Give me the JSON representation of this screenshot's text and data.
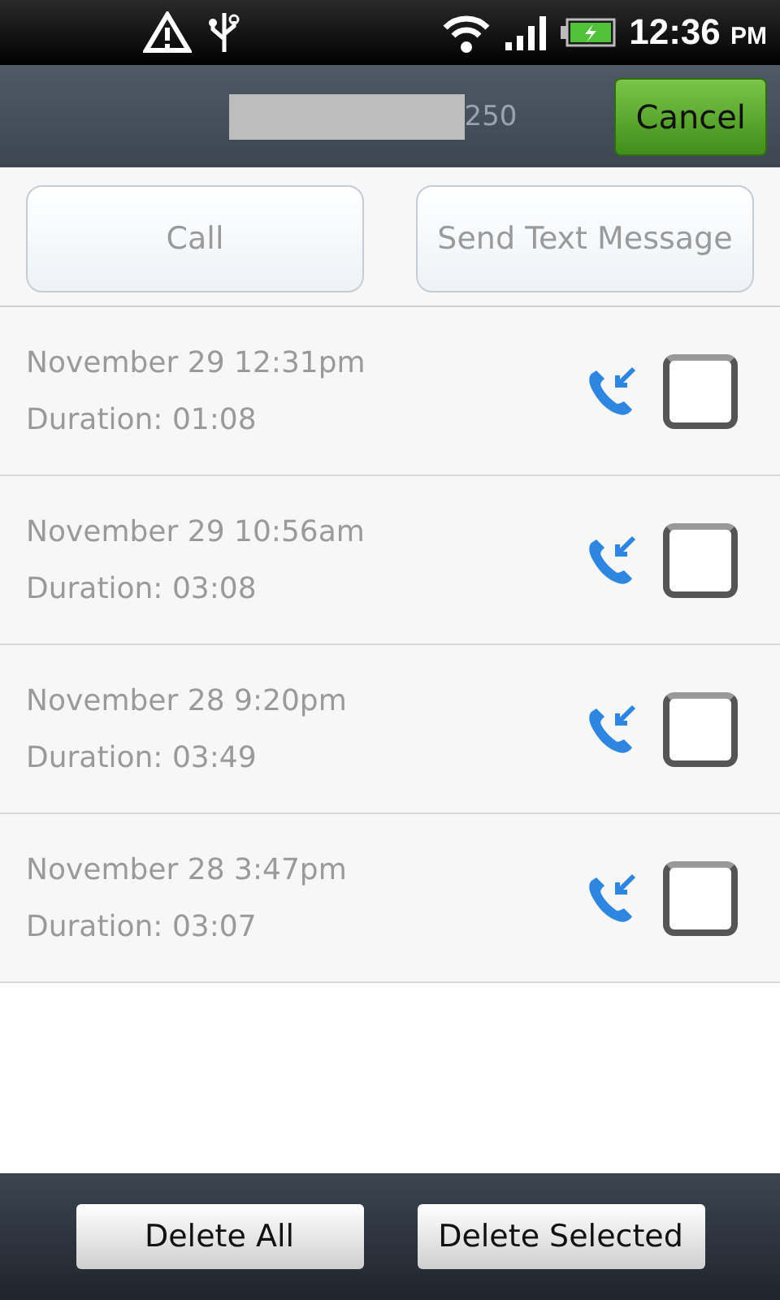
{
  "status_bar": {
    "time": "12:36",
    "ampm": "PM"
  },
  "header": {
    "title": "250",
    "cancel": "Cancel"
  },
  "actions": [
    "Call",
    "Send Text Message"
  ],
  "calls": [
    {
      "date": "November 29 12:31pm",
      "duration": "Duration: 01:08",
      "kind": "incoming",
      "checked": false
    },
    {
      "date": "November 29 10:56am",
      "duration": "Duration: 03:08",
      "kind": "incoming",
      "checked": false
    },
    {
      "date": "November 28 9:20pm",
      "duration": "Duration: 03:49",
      "kind": "incoming",
      "checked": false
    },
    {
      "date": "November 28 3:47pm",
      "duration": "Duration: 03:07",
      "kind": "incoming",
      "checked": false
    }
  ],
  "bottom_buttons": [
    "Delete All",
    "Delete Selected"
  ]
}
